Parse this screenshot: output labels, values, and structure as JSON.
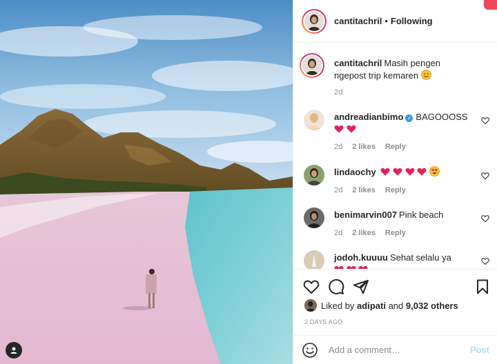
{
  "post": {
    "username": "cantitachril",
    "separator": "•",
    "follow_state": "Following"
  },
  "caption": {
    "username": "cantitachril",
    "text": "Masih pengen ngepost trip kemaren",
    "emoji": "smiling-face-emoji",
    "age": "2d"
  },
  "comments": [
    {
      "username": "andreadianbimo",
      "verified": true,
      "text": "BAGOOOSS",
      "emojis": [
        "heart-emoji",
        "heart-emoji"
      ],
      "age": "2d",
      "likes": "2 likes",
      "reply": "Reply"
    },
    {
      "username": "lindaochy",
      "verified": false,
      "text": "",
      "emojis": [
        "heart-emoji",
        "heart-emoji",
        "heart-emoji",
        "heart-emoji",
        "heart-eyes-emoji"
      ],
      "age": "2d",
      "likes": "2 likes",
      "reply": "Reply"
    },
    {
      "username": "benimarvin007",
      "verified": false,
      "text": "Pink beach",
      "emojis": [],
      "age": "2d",
      "likes": "2 likes",
      "reply": "Reply"
    },
    {
      "username": "jodoh.kuuuu",
      "verified": false,
      "text": "Sehat selalu ya",
      "emojis": [
        "heart-emoji",
        "heart-emoji",
        "heart-emoji"
      ],
      "age": "",
      "likes": "",
      "reply": ""
    }
  ],
  "likes": {
    "prefix": "Liked by",
    "user": "adipati",
    "joiner": "and",
    "others": "9,032 others"
  },
  "timestamp": "2 DAYS AGO",
  "composer": {
    "placeholder": "Add a comment…",
    "post_label": "Post"
  },
  "icons": {
    "like": "heart-outline-icon",
    "comment": "comment-bubble-icon",
    "share": "paper-plane-icon",
    "save": "bookmark-icon",
    "emoji_picker": "smiley-face-icon",
    "user_tag": "user-tag-icon"
  },
  "colors": {
    "text": "#262626",
    "muted": "#8e8e8e",
    "verified": "#3897f0",
    "post_disabled": "#b2dffc",
    "heart_emoji": "#e0245e"
  }
}
